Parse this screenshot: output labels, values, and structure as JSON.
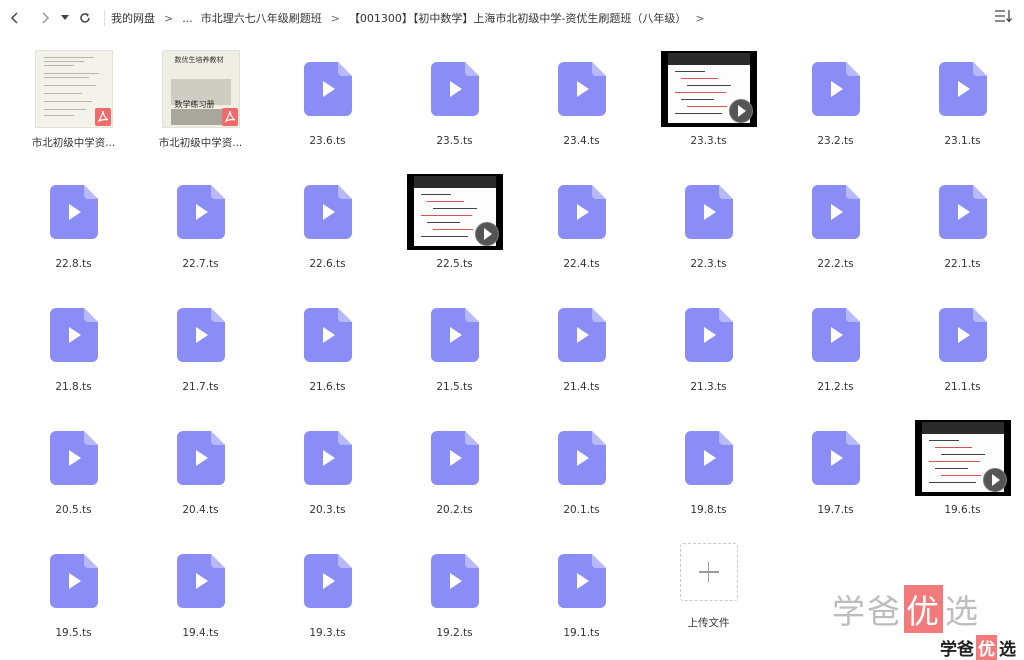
{
  "breadcrumb": {
    "root": "我的网盘",
    "sep": ">",
    "ellipsis": "...",
    "items": [
      "市北理六七八年级刷题班",
      "【001300】【初中数学】上海市北初级中学-资优生刷题班（八年级）"
    ]
  },
  "colors": {
    "video_icon": "#8a8df5",
    "pdf_badge": "#f06a6a"
  },
  "files": [
    {
      "name": "市北初级中学资...",
      "type": "pdf",
      "variant": 1
    },
    {
      "name": "市北初级中学资...",
      "type": "pdf",
      "variant": 2,
      "thumb_title": "数优生培养教材",
      "thumb_subtitle": "数学练习册"
    },
    {
      "name": "23.6.ts",
      "type": "video"
    },
    {
      "name": "23.5.ts",
      "type": "video"
    },
    {
      "name": "23.4.ts",
      "type": "video"
    },
    {
      "name": "23.3.ts",
      "type": "video_thumb"
    },
    {
      "name": "23.2.ts",
      "type": "video"
    },
    {
      "name": "23.1.ts",
      "type": "video"
    },
    {
      "name": "22.8.ts",
      "type": "video"
    },
    {
      "name": "22.7.ts",
      "type": "video"
    },
    {
      "name": "22.6.ts",
      "type": "video"
    },
    {
      "name": "22.5.ts",
      "type": "video_thumb"
    },
    {
      "name": "22.4.ts",
      "type": "video"
    },
    {
      "name": "22.3.ts",
      "type": "video"
    },
    {
      "name": "22.2.ts",
      "type": "video"
    },
    {
      "name": "22.1.ts",
      "type": "video"
    },
    {
      "name": "21.8.ts",
      "type": "video"
    },
    {
      "name": "21.7.ts",
      "type": "video"
    },
    {
      "name": "21.6.ts",
      "type": "video"
    },
    {
      "name": "21.5.ts",
      "type": "video"
    },
    {
      "name": "21.4.ts",
      "type": "video"
    },
    {
      "name": "21.3.ts",
      "type": "video"
    },
    {
      "name": "21.2.ts",
      "type": "video"
    },
    {
      "name": "21.1.ts",
      "type": "video"
    },
    {
      "name": "20.5.ts",
      "type": "video"
    },
    {
      "name": "20.4.ts",
      "type": "video"
    },
    {
      "name": "20.3.ts",
      "type": "video"
    },
    {
      "name": "20.2.ts",
      "type": "video"
    },
    {
      "name": "20.1.ts",
      "type": "video"
    },
    {
      "name": "19.8.ts",
      "type": "video"
    },
    {
      "name": "19.7.ts",
      "type": "video"
    },
    {
      "name": "19.6.ts",
      "type": "video_thumb"
    },
    {
      "name": "19.5.ts",
      "type": "video"
    },
    {
      "name": "19.4.ts",
      "type": "video"
    },
    {
      "name": "19.3.ts",
      "type": "video"
    },
    {
      "name": "19.2.ts",
      "type": "video"
    },
    {
      "name": "19.1.ts",
      "type": "video"
    }
  ],
  "upload": {
    "label": "上传文件"
  },
  "watermark": {
    "part1": "学爸",
    "highlight": "优",
    "part2": "选"
  }
}
